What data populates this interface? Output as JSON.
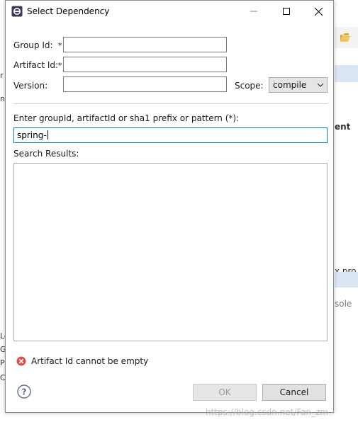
{
  "window": {
    "title": "Select Dependency"
  },
  "form": {
    "group_id_label": "Group Id:",
    "artifact_id_label": "Artifact Id:",
    "version_label": "Version:",
    "required_marker": "*",
    "group_id_value": "",
    "artifact_id_value": "",
    "version_value": "",
    "scope_label": "Scope:",
    "scope_value": "compile"
  },
  "search": {
    "label": "Enter groupId, artifactId or sha1 prefix or pattern (*):",
    "value": "spring-",
    "results_label": "Search Results:"
  },
  "status": {
    "message": "Artifact Id cannot be empty"
  },
  "buttons": {
    "ok": "OK",
    "cancel": "Cancel"
  },
  "background": {
    "right_texts": [
      "ent",
      "x pro",
      "sole"
    ],
    "left_texts": [
      "r",
      "n",
      "Lo",
      "Gl",
      "Pr",
      "Cu"
    ]
  },
  "watermark": "https://blog.csdn.net/Fan_zm",
  "colors": {
    "focus": "#0078d7",
    "error": "#d9534f",
    "band": "#dbe6f3"
  }
}
